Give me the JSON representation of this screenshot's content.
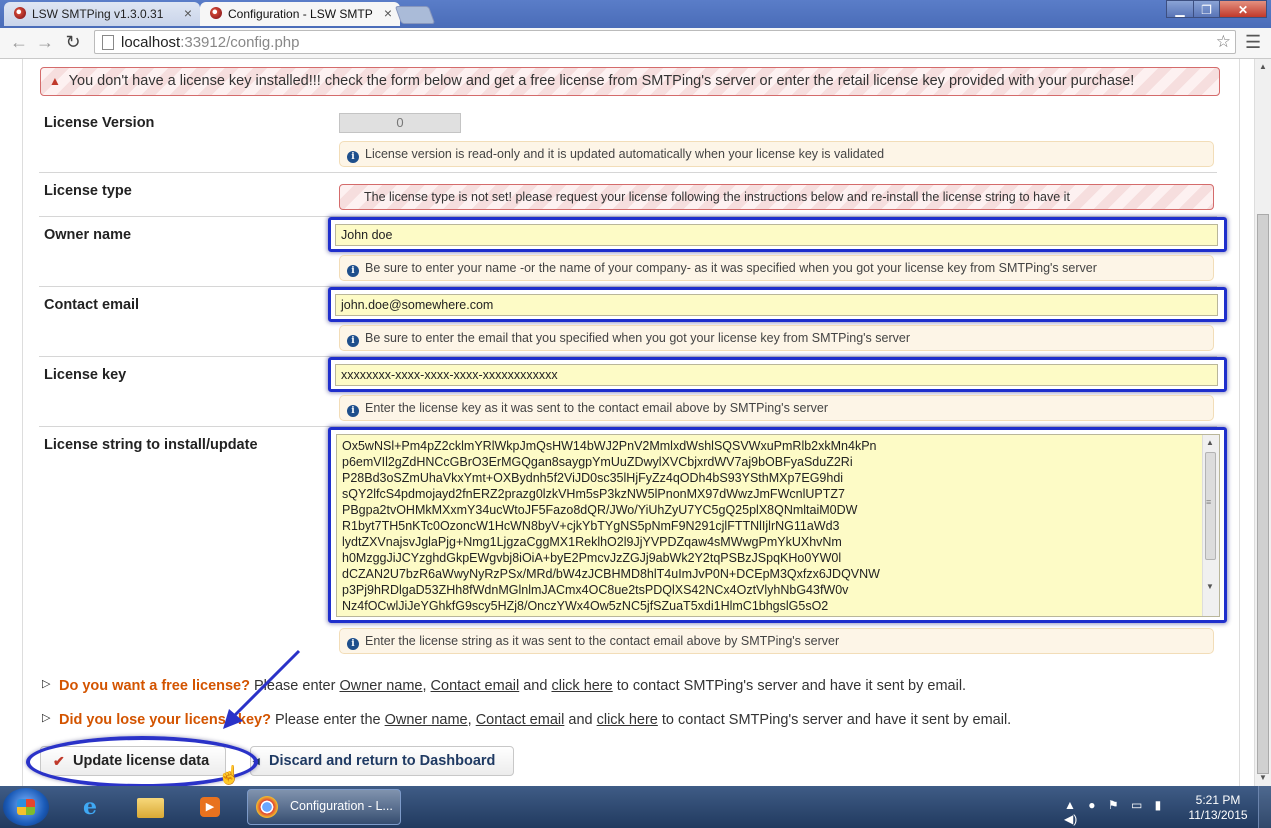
{
  "browser": {
    "tabs": [
      {
        "title": "LSW SMTPing v1.3.0.31",
        "active": false
      },
      {
        "title": "Configuration - LSW SMTP",
        "active": true
      }
    ],
    "url_host": "localhost",
    "url_rest": ":33912/config.php"
  },
  "alert": {
    "text": "You don't have a license key installed!!! check the form below and get a free license from SMTPing's server or enter the retail license key provided with your purchase!"
  },
  "form": {
    "version": {
      "label": "License Version",
      "value": "0",
      "help": "License version is read-only and it is updated automatically when your license key is validated"
    },
    "type": {
      "label": "License type",
      "alert": "The license type is not set! please request your license following the instructions below and re-install the license string to have it"
    },
    "owner": {
      "label": "Owner name",
      "value": "John doe",
      "help": "Be sure to enter your name -or the name of your company- as it was specified when you got your license key from SMTPing's server"
    },
    "email": {
      "label": "Contact email",
      "value": "john.doe@somewhere.com",
      "help": "Be sure to enter the email that you specified when you got your license key from SMTPing's server"
    },
    "key": {
      "label": "License key",
      "value": "xxxxxxxx-xxxx-xxxx-xxxx-xxxxxxxxxxxx",
      "help": "Enter the license key as it was sent to the contact email above by SMTPing's server"
    },
    "string": {
      "label": "License string to install/update",
      "value": "Ox5wNSl+Pm4pZ2cklmYRlWkpJmQsHW14bWJ2PnV2MmlxdWshlSQSVWxuPmRlb2xkMn4kPn\np6emVIl2gZdHNCcGBrO3ErMGQgan8saygpYmUuZDwylXVCbjxrdWV7aj9bOBFyaSduZ2Ri\nP28Bd3oSZmUhaVkxYmt+OXBydnh5f2ViJD0sc35lHjFyZz4qODh4bS93YSthMXp7EG9hdi\nsQY2lfcS4pdmojayd2fnERZ2prazg0lzkVHm5sP3kzNW5lPnonMX97dWwzJmFWcnlUPTZ7\nPBgpa2tvOHMkMXxmY34ucWtoJF5Fazo8dQR/JWo/YiUhZyU7YC5gQ25plX8QNmltaiM0DW\nR1byt7TH5nKTc0OzoncW1HcWN8byV+cjkYbTYgNS5pNmF9N291cjlFTTNlIjlrNG11aWd3\nlydtZXVnajsvJglaPjg+Nmg1LjgzaCggMX1ReklhO2l9JjYVPDZqaw4sMWwgPmYkUXhvNm\nh0MzggJiJCYzghdGkpEWgvbj8iOiA+byE2PmcvJzZGJj9abWk2Y2tqPSBzJSpqKHo0YW0l\ndCZAN2U7bzR6aWwyNyRzPSx/MRd/bW4zJCBHMD8hlT4uImJvP0N+DCEpM3Qxfzx6JDQVNW\np3Pj9hRDlgaD53ZHh8fWdnMGlnlmJACmx4OC8ue2tsPDQlXS42NCx4OztVlyhNbG43fW0v\nNz4fOCwlJiJeYGhkfG9scy5HZj8/OnczYWx4Ow5zNC5jfSZuaT5xdi1HlmC1bhgslG5sO2"
    },
    "string_help": "Enter the license string as it was sent to the contact email above by SMTPing's server"
  },
  "questions": {
    "free": {
      "question": "Do you want a free license?",
      "prefix": "Please enter",
      "owner_link": "Owner name",
      "comma": ",",
      "email_link": "Contact email",
      "and": "and",
      "click_link": "click here",
      "suffix": "to contact SMTPing's server and have it sent by email."
    },
    "lost": {
      "question": "Did you lose your license key?",
      "prefix": "Please enter the",
      "owner_link": "Owner name",
      "comma": ",",
      "email_link": "Contact email",
      "and": "and",
      "click_link": "click here",
      "suffix": "to contact SMTPing's server and have it sent by email."
    }
  },
  "buttons": {
    "update": "Update license data",
    "discard": "Discard and return to Dashboard"
  },
  "taskbar": {
    "chrome_task": "Configuration - L...",
    "time": "5:21 PM",
    "date": "11/13/2015"
  },
  "colors": {
    "focus_ring": "#1f2fcc",
    "input_bg": "#fdfbc6",
    "help_bg": "#fdf5e7",
    "question_accent": "#d35400",
    "alert_border": "#d46b6b"
  },
  "icons": [
    "warning-icon",
    "info-icon",
    "check-icon",
    "arrow-left-icon",
    "star-icon",
    "menu-icon",
    "reload-icon",
    "back-icon",
    "forward-icon",
    "windows-start-icon",
    "ie-icon",
    "explorer-icon",
    "media-player-icon",
    "chrome-icon",
    "cursor-icon"
  ]
}
